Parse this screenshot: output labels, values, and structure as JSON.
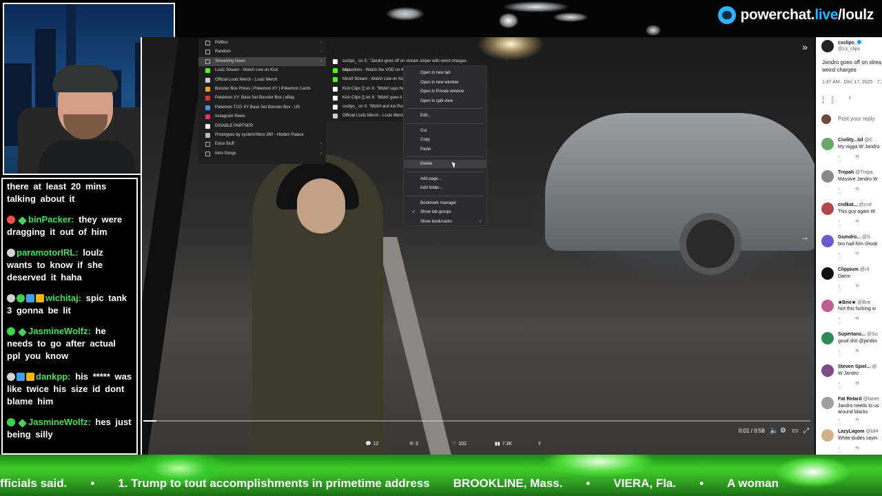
{
  "brand": {
    "pre": "powerchat.",
    "live": "live",
    "post": "/loulz"
  },
  "chat": [
    {
      "badges": [],
      "user": "",
      "text": "there at least 20 mins talking about it"
    },
    {
      "badges": [
        "red",
        "diamond"
      ],
      "user": "binPacker:",
      "text": "they were dragging it out of him"
    },
    {
      "badges": [
        "gray"
      ],
      "user": "paramotorIRL:",
      "text": "loulz wants to know if she deserved it haha"
    },
    {
      "badges": [
        "gray",
        "green",
        "blue",
        "gold"
      ],
      "user": "wichitaj:",
      "text": "spic tank 3 gonna be lit"
    },
    {
      "badges": [
        "green",
        "diamond"
      ],
      "user": "JasmineWolfz:",
      "text": "he needs to go after actual ppl you know"
    },
    {
      "badges": [
        "gray",
        "blue",
        "gold"
      ],
      "user": "dankpp:",
      "text": "his ***** was like twice his size id dont blame him"
    },
    {
      "badges": [
        "green",
        "diamond"
      ],
      "user": "JasmineWolfz:",
      "text": "hes just being silly"
    }
  ],
  "bookmarks": {
    "items": [
      {
        "label": "Politics",
        "folder": true,
        "chev": true
      },
      {
        "label": "Random",
        "folder": true,
        "chev": true
      },
      {
        "label": "Streaming News",
        "folder": true,
        "chev": true,
        "active": true
      },
      {
        "label": "Loulz Stream - Watch Live on Kick",
        "icon": "#53fc18"
      },
      {
        "label": "Official Loulz Merch - Loulz Merch",
        "icon": "#ccc"
      },
      {
        "label": "Booster Box Prices | Pokemon XY | Pokemon Cards",
        "icon": "#f0a020"
      },
      {
        "label": "Pokémon XY: Base Set Booster Box | eBay",
        "icon": "#e53238"
      },
      {
        "label": "Pokémon TCG XY Base Set Booster Box - US",
        "icon": "#4a90e2"
      },
      {
        "label": "Instagram Reels",
        "icon": "#e1306c"
      },
      {
        "label": "DISABLE PARTNER",
        "icon": "#eee"
      },
      {
        "label": "Prototypes by system/Xbox 360 - Hidden Palace",
        "icon": "#bbb"
      },
      {
        "label": "Extra Stuff",
        "folder": true,
        "chev": true
      },
      {
        "label": "Intro Songs",
        "folder": true,
        "chev": true
      }
    ],
    "sub": [
      {
        "label": "cxclips_ on X: \"Jandro goes off on stream sniper with weird charges http...",
        "icon": "#fff"
      },
      {
        "label": "boneclinks - Watch the VOD on Kic",
        "icon": "#53fc18"
      },
      {
        "label": "Mizkif Stream - Watch Live on Kick",
        "icon": "#53fc18"
      },
      {
        "label": "Kick Clips ▒ on X: \"Mizkif says he'",
        "icon": "#fff"
      },
      {
        "label": "Kick Clips ▒ on X: \"Mizkif goes li",
        "icon": "#fff"
      },
      {
        "label": "cxclips_ on X: \"Mizkif and Ice Poseic",
        "icon": "#fff"
      },
      {
        "label": "Official Loulz Merch - Loulz Merch",
        "icon": "#ccc"
      }
    ]
  },
  "context_menu": {
    "groups": [
      [
        "Open in new tab",
        "Open in new window",
        "Open in Private window",
        "Open in split view"
      ],
      [
        "Edit..."
      ],
      [
        "Cut",
        "Copy",
        "Paste"
      ],
      [
        "Delete"
      ],
      [
        "Add page...",
        "Add folder..."
      ],
      [
        "Bookmark manager",
        "Show tab groups",
        "Show bookmarks"
      ]
    ],
    "checked": "Show tab groups",
    "hover": "Delete"
  },
  "player": {
    "time": "0:01 / 0:58",
    "progress": 0.02
  },
  "stats": {
    "replies": "12",
    "reposts": "3",
    "likes": "102",
    "views": "7.3K"
  },
  "feed": {
    "author": "cxclips_",
    "handle": "@cx_clips",
    "text1": "Jandro goes off on strea",
    "text2": "weird charges",
    "time": "1:47 AM · Dec 17, 2025 · 7.3",
    "counts": "12   3   10",
    "reply_prompt": "Post your reply",
    "replies": [
      {
        "name": "Civility...lol",
        "handle": "@C",
        "text": "My nigga W Jandro",
        "color": "#6aa86a"
      },
      {
        "name": "Tropah",
        "handle": "@Tropa",
        "text": "Massive Jandro W",
        "color": "#8a8a8a"
      },
      {
        "name": "cndkat...",
        "handle": "@cnd",
        "text": "This guy again W",
        "color": "#b04a4a"
      },
      {
        "name": "Gumdro...",
        "handle": "@S",
        "text": "bro had him shook",
        "color": "#6a5acd"
      },
      {
        "name": "Clippium",
        "handle": "@cli",
        "text": "Damn",
        "color": "#111"
      },
      {
        "name": "★Brie★",
        "handle": "@Brie",
        "text": "Not this fucking w",
        "color": "#c06090"
      },
      {
        "name": "Supertans...",
        "handle": "@Su",
        "text": "good shit @jandro",
        "color": "#2e8b57"
      },
      {
        "name": "Steven Spiel...",
        "handle": "@",
        "text": "W Jandro",
        "color": "#7a4a8a"
      },
      {
        "name": "Fat Retard",
        "handle": "@fatret",
        "text": "Jandro needs to us",
        "text2": "around blacks",
        "color": "#a0a0a0"
      },
      {
        "name": "LazyLagom",
        "handle": "@lol4",
        "text": "White dudes sayin",
        "color": "#d2b48c"
      }
    ]
  },
  "ticker": [
    "fficials said.",
    "•",
    "1. Trump to tout accomplishments in primetime address",
    "BROOKLINE, Mass.",
    "•",
    "VIERA, Fla.",
    "•",
    "A woman"
  ]
}
